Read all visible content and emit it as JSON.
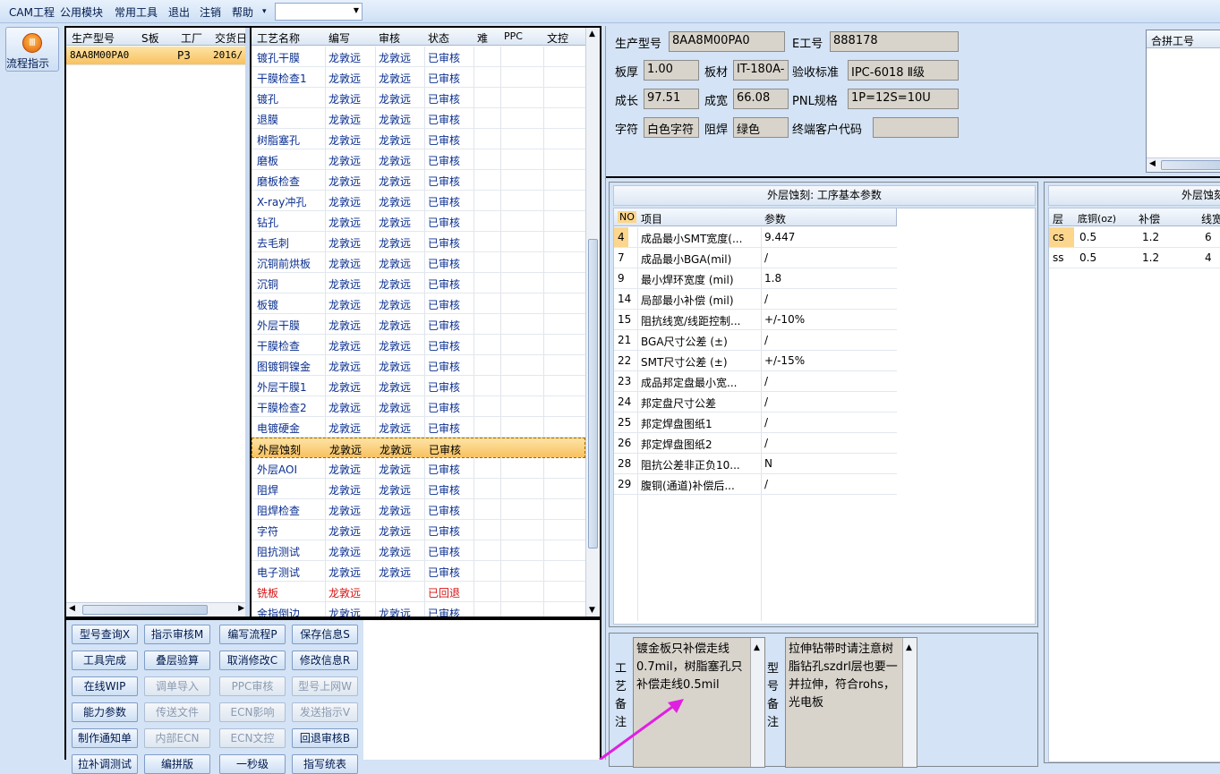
{
  "menu": {
    "items": [
      "CAM工程",
      "公用模块",
      "常用工具",
      "退出",
      "注销",
      "帮助"
    ],
    "expand_glyph": "▾",
    "combo_value": ""
  },
  "flow_button": {
    "label": "流程指示",
    "icon": "flow-icon",
    "icon_glyph": "Ⅲ"
  },
  "orders": {
    "headers": [
      "生产型号",
      "S板",
      "工厂",
      "交货日"
    ],
    "rows": [
      {
        "model": "8AA8M00PA0",
        "s": "",
        "factory": "P3",
        "date": "2016/"
      }
    ]
  },
  "processes": {
    "headers": [
      "工艺名称",
      "编写",
      "审核",
      "状态",
      "难",
      "PPC",
      "文控"
    ],
    "rows": [
      {
        "name": "镀孔干膜",
        "writer": "龙敦远",
        "reviewer": "龙敦远",
        "status": "已审核"
      },
      {
        "name": "干膜检查1",
        "writer": "龙敦远",
        "reviewer": "龙敦远",
        "status": "已审核"
      },
      {
        "name": "镀孔",
        "writer": "龙敦远",
        "reviewer": "龙敦远",
        "status": "已审核"
      },
      {
        "name": "退膜",
        "writer": "龙敦远",
        "reviewer": "龙敦远",
        "status": "已审核"
      },
      {
        "name": "树脂塞孔",
        "writer": "龙敦远",
        "reviewer": "龙敦远",
        "status": "已审核"
      },
      {
        "name": "磨板",
        "writer": "龙敦远",
        "reviewer": "龙敦远",
        "status": "已审核"
      },
      {
        "name": "磨板检查",
        "writer": "龙敦远",
        "reviewer": "龙敦远",
        "status": "已审核"
      },
      {
        "name": "X-ray冲孔",
        "writer": "龙敦远",
        "reviewer": "龙敦远",
        "status": "已审核"
      },
      {
        "name": "钻孔",
        "writer": "龙敦远",
        "reviewer": "龙敦远",
        "status": "已审核"
      },
      {
        "name": "去毛刺",
        "writer": "龙敦远",
        "reviewer": "龙敦远",
        "status": "已审核"
      },
      {
        "name": "沉铜前烘板",
        "writer": "龙敦远",
        "reviewer": "龙敦远",
        "status": "已审核"
      },
      {
        "name": "沉铜",
        "writer": "龙敦远",
        "reviewer": "龙敦远",
        "status": "已审核"
      },
      {
        "name": "板镀",
        "writer": "龙敦远",
        "reviewer": "龙敦远",
        "status": "已审核"
      },
      {
        "name": "外层干膜",
        "writer": "龙敦远",
        "reviewer": "龙敦远",
        "status": "已审核"
      },
      {
        "name": "干膜检查",
        "writer": "龙敦远",
        "reviewer": "龙敦远",
        "status": "已审核"
      },
      {
        "name": "图镀铜镍金",
        "writer": "龙敦远",
        "reviewer": "龙敦远",
        "status": "已审核"
      },
      {
        "name": "外层干膜1",
        "writer": "龙敦远",
        "reviewer": "龙敦远",
        "status": "已审核"
      },
      {
        "name": "干膜检查2",
        "writer": "龙敦远",
        "reviewer": "龙敦远",
        "status": "已审核"
      },
      {
        "name": "电镀硬金",
        "writer": "龙敦远",
        "reviewer": "龙敦远",
        "status": "已审核"
      },
      {
        "name": "外层蚀刻",
        "writer": "龙敦远",
        "reviewer": "龙敦远",
        "status": "已审核",
        "selected": true
      },
      {
        "name": "外层AOI",
        "writer": "龙敦远",
        "reviewer": "龙敦远",
        "status": "已审核"
      },
      {
        "name": "阻焊",
        "writer": "龙敦远",
        "reviewer": "龙敦远",
        "status": "已审核"
      },
      {
        "name": "阻焊检查",
        "writer": "龙敦远",
        "reviewer": "龙敦远",
        "status": "已审核"
      },
      {
        "name": "字符",
        "writer": "龙敦远",
        "reviewer": "龙敦远",
        "status": "已审核"
      },
      {
        "name": "阻抗测试",
        "writer": "龙敦远",
        "reviewer": "龙敦远",
        "status": "已审核"
      },
      {
        "name": "电子测试",
        "writer": "龙敦远",
        "reviewer": "龙敦远",
        "status": "已审核"
      },
      {
        "name": "铣板",
        "writer": "龙敦远",
        "reviewer": "",
        "status": "已回退",
        "rejected": true
      },
      {
        "name": "金指倒边",
        "writer": "龙敦远",
        "reviewer": "龙敦远",
        "status": "已审核"
      }
    ]
  },
  "buttons": [
    [
      "型号查询X",
      "指示审核M",
      "编写流程P",
      "保存信息S"
    ],
    [
      "工具完成",
      "叠层验算",
      "取消修改C",
      "修改信息R"
    ],
    [
      "在线WIP",
      "调单导入",
      "PPC审核",
      "型号上网W"
    ],
    [
      "能力参数",
      "传送文件",
      "ECN影响",
      "发送指示V"
    ],
    [
      "制作通知单",
      "内部ECN",
      "ECN文控",
      "回退审核B"
    ],
    [
      "拉补调测试",
      "编拼版",
      "一秒级",
      "指写统表"
    ]
  ],
  "disabled_buttons": [
    "调单导入",
    "PPC审核",
    "型号上网W",
    "传送文件",
    "ECN影响",
    "发送指示V",
    "内部ECN",
    "ECN文控"
  ],
  "info": {
    "model_label": "生产型号",
    "model": "8AA8M00PA0",
    "eng_label": "E工号",
    "eng": "888178",
    "thick_label": "板厚",
    "thick": "1.00",
    "material_label": "板材",
    "material": "IT-180A-",
    "std_label": "验收标准",
    "std": "IPC-6018 Ⅱ级",
    "len_label": "成长",
    "len": "97.51",
    "width_label": "成宽",
    "width": "66.08",
    "pnl_label": "PNL规格",
    "pnl": "1P=12S=10U",
    "char_label": "字符",
    "char": "白色字符",
    "mask_label": "阻焊",
    "mask": "绿色",
    "cust_label": "终端客户代码",
    "cust": ""
  },
  "merge": {
    "header": "合拼工号"
  },
  "params": {
    "title": "外层蚀刻: 工序基本参数",
    "headers": [
      "NO",
      "项目",
      "参数"
    ],
    "rows": [
      {
        "no": "4",
        "item": "成品最小SMT宽度(...",
        "val": "9.447",
        "selected": true
      },
      {
        "no": "7",
        "item": "成品最小BGA(mil)",
        "val": "/"
      },
      {
        "no": "9",
        "item": "最小焊环宽度 (mil)",
        "val": "1.8"
      },
      {
        "no": "14",
        "item": "局部最小补偿 (mil)",
        "val": "/"
      },
      {
        "no": "15",
        "item": "阻抗线宽/线距控制...",
        "val": "+/-10%"
      },
      {
        "no": "21",
        "item": "BGA尺寸公差 (±)",
        "val": "/"
      },
      {
        "no": "22",
        "item": "SMT尺寸公差 (±)",
        "val": "+/-15%"
      },
      {
        "no": "23",
        "item": "成品邦定盘最小宽...",
        "val": "/"
      },
      {
        "no": "24",
        "item": "邦定盘尺寸公差",
        "val": "/"
      },
      {
        "no": "25",
        "item": "邦定焊盘图纸1",
        "val": "/"
      },
      {
        "no": "26",
        "item": "邦定焊盘图纸2",
        "val": "/"
      },
      {
        "no": "28",
        "item": "阻抗公差非正负10...",
        "val": "N"
      },
      {
        "no": "29",
        "item": "腹铜(通道)补偿后...",
        "val": "/"
      }
    ]
  },
  "layers": {
    "title": "外层蚀刻",
    "headers": [
      "层",
      "底铜(oz)",
      "补偿",
      "线宽"
    ],
    "rows": [
      {
        "layer": "cs",
        "base": "0.5",
        "comp": "1.2",
        "w": "6",
        "selected": true
      },
      {
        "layer": "ss",
        "base": "0.5",
        "comp": "1.2",
        "w": "4"
      }
    ]
  },
  "remarks": {
    "process_label": "工艺备注",
    "process_text": "镀金板只补偿走线0.7mil，树脂塞孔只补偿走线0.5mil",
    "model_label": "型号备注",
    "model_text": "拉伸钻带时请注意树脂钻孔szdrl层也要一并拉伸，符合rohs，光电板"
  }
}
